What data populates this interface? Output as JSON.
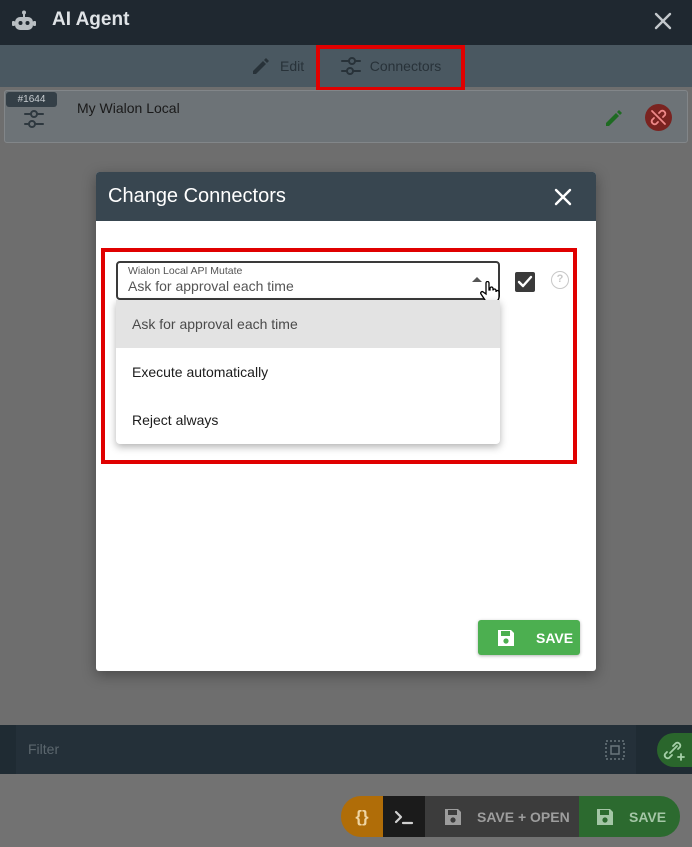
{
  "window": {
    "title": "AI Agent",
    "icon": "robot-icon",
    "close_icon": "close-icon"
  },
  "tabs": [
    {
      "label": "Edit",
      "icon": "pencil-icon"
    },
    {
      "label": "Connectors",
      "icon": "sliders-icon",
      "active": true
    }
  ],
  "connector": {
    "id_badge": "#1644",
    "name": "My Wialon Local",
    "icon": "sliders-icon"
  },
  "dialog": {
    "title": "Change Connectors",
    "select": {
      "label": "Wialon Local API Mutate",
      "value": "Ask for approval each time"
    },
    "checkbox_checked": true,
    "help_symbol": "?",
    "options": [
      {
        "label": "Ask for approval each time",
        "selected": true
      },
      {
        "label": "Execute automatically",
        "selected": false
      },
      {
        "label": "Reject always",
        "selected": false
      }
    ],
    "save_label": "SAVE"
  },
  "filter": {
    "placeholder": "Filter"
  },
  "toolbar": {
    "json_label": "{}",
    "save_open_label": "SAVE + OPEN",
    "save_label": "SAVE"
  },
  "colors": {
    "highlight": "#e00000",
    "save_green": "#4caf50",
    "header_dark": "#384650"
  }
}
